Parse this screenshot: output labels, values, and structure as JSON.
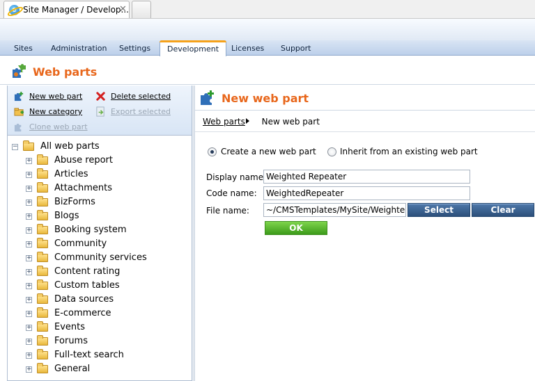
{
  "browser": {
    "tab_title": "Site Manager / Develop...",
    "close_glyph": "✕"
  },
  "nav": {
    "tabs": [
      "Sites",
      "Administration",
      "Settings",
      "Development",
      "Licenses",
      "Support"
    ],
    "active": "Development"
  },
  "page": {
    "title": "Web parts"
  },
  "left": {
    "actions": {
      "new_web_part": "New web part",
      "delete_selected": "Delete selected",
      "new_category": "New category",
      "export_selected": "Export selected",
      "clone_web_part": "Clone web part"
    },
    "tree_root": "All web parts",
    "tree_items": [
      "Abuse report",
      "Articles",
      "Attachments",
      "BizForms",
      "Blogs",
      "Booking system",
      "Community",
      "Community services",
      "Content rating",
      "Custom tables",
      "Data sources",
      "E-commerce",
      "Events",
      "Forums",
      "Full-text search",
      "General"
    ]
  },
  "right": {
    "title": "New web part",
    "breadcrumb": {
      "parent": "Web parts",
      "current": "New web part"
    },
    "radio_create": "Create a new web part",
    "radio_inherit": "Inherit from an existing web part",
    "display_name_label": "Display name:",
    "display_name_value": "Weighted Repeater",
    "code_name_label": "Code name:",
    "code_name_value": "WeightedRepeater",
    "file_name_label": "File name:",
    "file_name_value": "~/CMSTemplates/MySite/Weighted",
    "select_button": "Select",
    "clear_button": "Clear",
    "ok_button": "OK"
  },
  "colors": {
    "accent_orange": "#e8671c",
    "select_blue": "#2c4f7a",
    "ok_green": "#3c9b1a",
    "active_tab_marker": "#f6a21a"
  },
  "icons": [
    "ie-icon",
    "puzzle-icon",
    "add-puzzle-icon",
    "delete-icon",
    "new-category-icon",
    "export-icon",
    "clone-icon",
    "folder-icon",
    "expand-icon",
    "collapse-icon",
    "breadcrumb-arrow-icon",
    "close-icon"
  ]
}
